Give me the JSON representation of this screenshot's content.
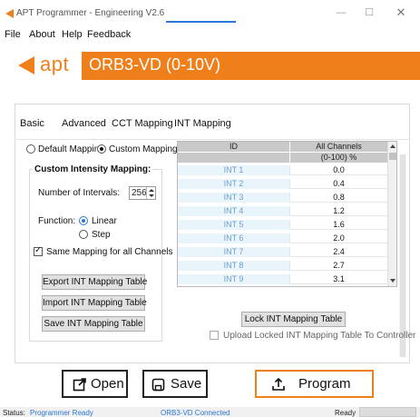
{
  "window": {
    "title": "APT Programmer - Engineering V2.6",
    "minimize_glyph": "—",
    "maximize_glyph": "☐",
    "close_glyph": "✕"
  },
  "menu": {
    "items": [
      "File",
      "About",
      "Help",
      "Feedback"
    ]
  },
  "banner": {
    "brand": "apt",
    "model": "ORB3-VD (0-10V)",
    "accent_color": "#ee7f1b"
  },
  "tabs": {
    "items": [
      "Basic",
      "Advanced",
      "CCT Mapping",
      "INT Mapping"
    ],
    "active": "INT Mapping"
  },
  "mapping_mode": {
    "default_label": "Default Mapping",
    "custom_label": "Custom Mapping",
    "selected": "Custom Mapping"
  },
  "custom_intensity": {
    "title": "Custom Intensity Mapping:",
    "intervals_label": "Number of Intervals:",
    "intervals_value": "256",
    "function_label": "Function:",
    "linear_label": "Linear",
    "step_label": "Step",
    "function_selected": "Linear",
    "same_mapping_label": "Same Mapping for all Channels",
    "same_mapping_checked": true,
    "export_label": "Export INT Mapping Table",
    "import_label": "Import INT Mapping Table",
    "save_label": "Save INT Mapping Table"
  },
  "table": {
    "header_id": "ID",
    "header_all": "All Channels",
    "subheader_unit": "(0-100) %",
    "rows": [
      {
        "id": "INT 1",
        "value": "0.0"
      },
      {
        "id": "INT 2",
        "value": "0.4"
      },
      {
        "id": "INT 3",
        "value": "0.8"
      },
      {
        "id": "INT 4",
        "value": "1.2"
      },
      {
        "id": "INT 5",
        "value": "1.6"
      },
      {
        "id": "INT 6",
        "value": "2.0"
      },
      {
        "id": "INT 7",
        "value": "2.4"
      },
      {
        "id": "INT 8",
        "value": "2.7"
      },
      {
        "id": "INT 9",
        "value": "3.1"
      }
    ]
  },
  "lock": {
    "button_label": "Lock INT Mapping Table",
    "upload_label": "Upload Locked INT Mapping Table To Controller",
    "upload_checked": false
  },
  "actions": {
    "open_label": "Open",
    "save_label": "Save",
    "program_label": "Program"
  },
  "status": {
    "status_label": "Status:",
    "status_value": "Programmer Ready",
    "device_status": "ORB3-VD Connected",
    "ready": "Ready",
    "status_color": "#2a78d6"
  }
}
